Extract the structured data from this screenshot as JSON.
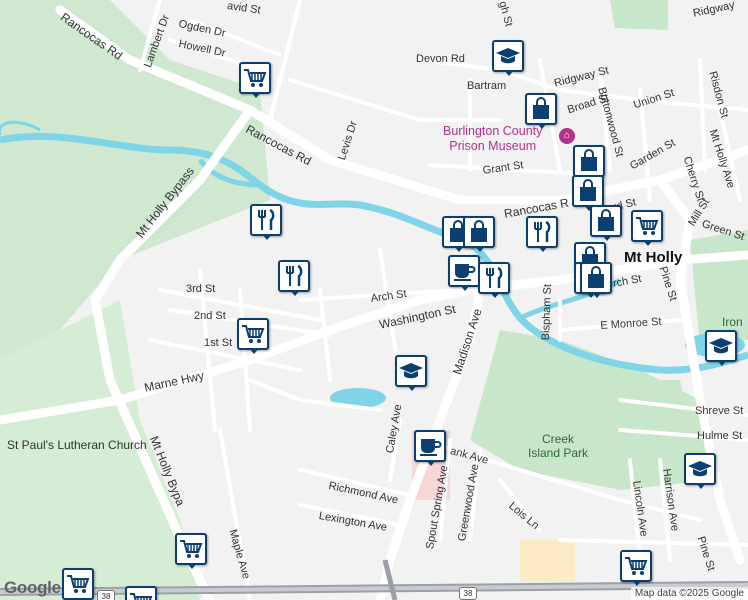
{
  "map": {
    "streets": [
      {
        "id": "lambert-dr",
        "text": "Lambert Dr"
      },
      {
        "id": "ogden-dr",
        "text": "Ogden Dr"
      },
      {
        "id": "howell-dr",
        "text": "Howell Dr"
      },
      {
        "id": "david-st",
        "text": "avid St"
      },
      {
        "id": "rancocas-rd-nw",
        "text": "Rancocas Rd"
      },
      {
        "id": "rancocas-rd-mid",
        "text": "Rancocas Rd"
      },
      {
        "id": "rancocas-rd-east",
        "text": "Rancocas R"
      },
      {
        "id": "levis-dr",
        "text": "Levis Dr"
      },
      {
        "id": "mt-holly-bypass-n",
        "text": "Mt Holly Bypass"
      },
      {
        "id": "mt-holly-bypass-s",
        "text": "Mt Holly Bypa"
      },
      {
        "id": "devon-rd",
        "text": "Devon Rd"
      },
      {
        "id": "bartram",
        "text": "Bartram"
      },
      {
        "id": "ridgway-st",
        "text": "Ridgway St"
      },
      {
        "id": "ridgway-ne",
        "text": "Ridgway"
      },
      {
        "id": "risdon-st",
        "text": "Risdon St"
      },
      {
        "id": "broad-st",
        "text": "Broad St"
      },
      {
        "id": "buttonwood-st",
        "text": "Buttonwood St"
      },
      {
        "id": "union-st",
        "text": "Union St"
      },
      {
        "id": "high-st",
        "text": "gh St"
      },
      {
        "id": "grant-st",
        "text": "Grant St"
      },
      {
        "id": "garden-st",
        "text": "Garden St"
      },
      {
        "id": "mt-holly-ave",
        "text": "Mt Holly Ave"
      },
      {
        "id": "cherry-st",
        "text": "Cherry St"
      },
      {
        "id": "shepherd-st",
        "text": "herd St"
      },
      {
        "id": "green-st",
        "text": "Green St"
      },
      {
        "id": "mill-st",
        "text": "Mill St"
      },
      {
        "id": "church-st",
        "text": "rch St"
      },
      {
        "id": "pine-st-n",
        "text": "Pine St"
      },
      {
        "id": "pine-st-s",
        "text": "Pine St"
      },
      {
        "id": "3rd-st",
        "text": "3rd St"
      },
      {
        "id": "2nd-st",
        "text": "2nd St"
      },
      {
        "id": "1st-st",
        "text": "1st St"
      },
      {
        "id": "arch-st",
        "text": "Arch St"
      },
      {
        "id": "washington-st",
        "text": "Washington St"
      },
      {
        "id": "madison-ave",
        "text": "Madison Ave"
      },
      {
        "id": "bispham-st",
        "text": "Bispham St"
      },
      {
        "id": "e-monroe-st",
        "text": "E Monroe St"
      },
      {
        "id": "marne-hwy",
        "text": "Marne Hwy"
      },
      {
        "id": "caley-ave",
        "text": "Caley Ave"
      },
      {
        "id": "shreve-st",
        "text": "Shreve St"
      },
      {
        "id": "hulme-st",
        "text": "Hulme St"
      },
      {
        "id": "hank-ave",
        "text": "ank Ave"
      },
      {
        "id": "richmond-ave",
        "text": "Richmond Ave"
      },
      {
        "id": "lexington-ave",
        "text": "Lexington Ave"
      },
      {
        "id": "spout-spring-ave",
        "text": "Spout Spring Ave"
      },
      {
        "id": "greenwood-ave",
        "text": "Greenwood Ave"
      },
      {
        "id": "lois-ln",
        "text": "Lois Ln"
      },
      {
        "id": "harrison-ave",
        "text": "Harrison Ave"
      },
      {
        "id": "lincoln-ave",
        "text": "Lincoln Ave"
      },
      {
        "id": "maple-ave",
        "text": "Maple Ave"
      }
    ],
    "poi": {
      "line1": "Burlington County",
      "line2": "Prison Museum"
    },
    "place": "Mt Holly",
    "park": {
      "line1": "Creek",
      "line2": "Island Park"
    },
    "church": "St Paul's Lutheran Church",
    "iron_label": "Iron",
    "route_shield": "38",
    "google_logo": "Google",
    "attribution": "Map data ©2025 Google",
    "colors": {
      "marker_border": "#0b3f6f",
      "park_green": "#c8e6c9",
      "water": "#7fd4e8",
      "poi_text": "#b0338a",
      "road_white": "#ffffff",
      "highway": "#9aa0a6"
    },
    "markers": [
      {
        "id": "shopping-cart-1",
        "icon": "shopping-cart-icon"
      },
      {
        "id": "graduation-cap-1",
        "icon": "graduation-cap-icon"
      },
      {
        "id": "shopping-bag-1",
        "icon": "shopping-bag-icon"
      },
      {
        "id": "restaurant-1",
        "icon": "restaurant-icon"
      },
      {
        "id": "restaurant-2",
        "icon": "restaurant-icon"
      },
      {
        "id": "shopping-cart-2",
        "icon": "shopping-cart-icon"
      },
      {
        "id": "shopping-bag-2",
        "icon": "shopping-bag-icon"
      },
      {
        "id": "shopping-bag-3",
        "icon": "shopping-bag-icon"
      },
      {
        "id": "cafe-1",
        "icon": "coffee-cup-icon"
      },
      {
        "id": "restaurant-3",
        "icon": "restaurant-icon"
      },
      {
        "id": "graduation-cap-2",
        "icon": "graduation-cap-icon"
      },
      {
        "id": "cafe-2",
        "icon": "coffee-cup-icon"
      },
      {
        "id": "downtown-cluster-1",
        "icon": "shopping-bag-icon"
      },
      {
        "id": "downtown-cluster-2",
        "icon": "shopping-bag-icon"
      },
      {
        "id": "downtown-cluster-3",
        "icon": "shopping-bag-icon"
      },
      {
        "id": "restaurant-4",
        "icon": "restaurant-icon"
      },
      {
        "id": "shopping-bag-4",
        "icon": "shopping-bag-icon"
      },
      {
        "id": "shopping-cart-3",
        "icon": "shopping-cart-icon"
      },
      {
        "id": "shopping-bag-5",
        "icon": "shopping-bag-icon"
      },
      {
        "id": "shopping-bag-6",
        "icon": "shopping-bag-icon"
      },
      {
        "id": "graduation-cap-3",
        "icon": "graduation-cap-icon"
      },
      {
        "id": "graduation-cap-4",
        "icon": "graduation-cap-icon"
      },
      {
        "id": "shopping-cart-4",
        "icon": "shopping-cart-icon"
      },
      {
        "id": "shopping-cart-5",
        "icon": "shopping-cart-icon"
      },
      {
        "id": "shopping-cart-6",
        "icon": "shopping-cart-icon"
      },
      {
        "id": "shopping-cart-7",
        "icon": "shopping-cart-icon"
      }
    ]
  }
}
